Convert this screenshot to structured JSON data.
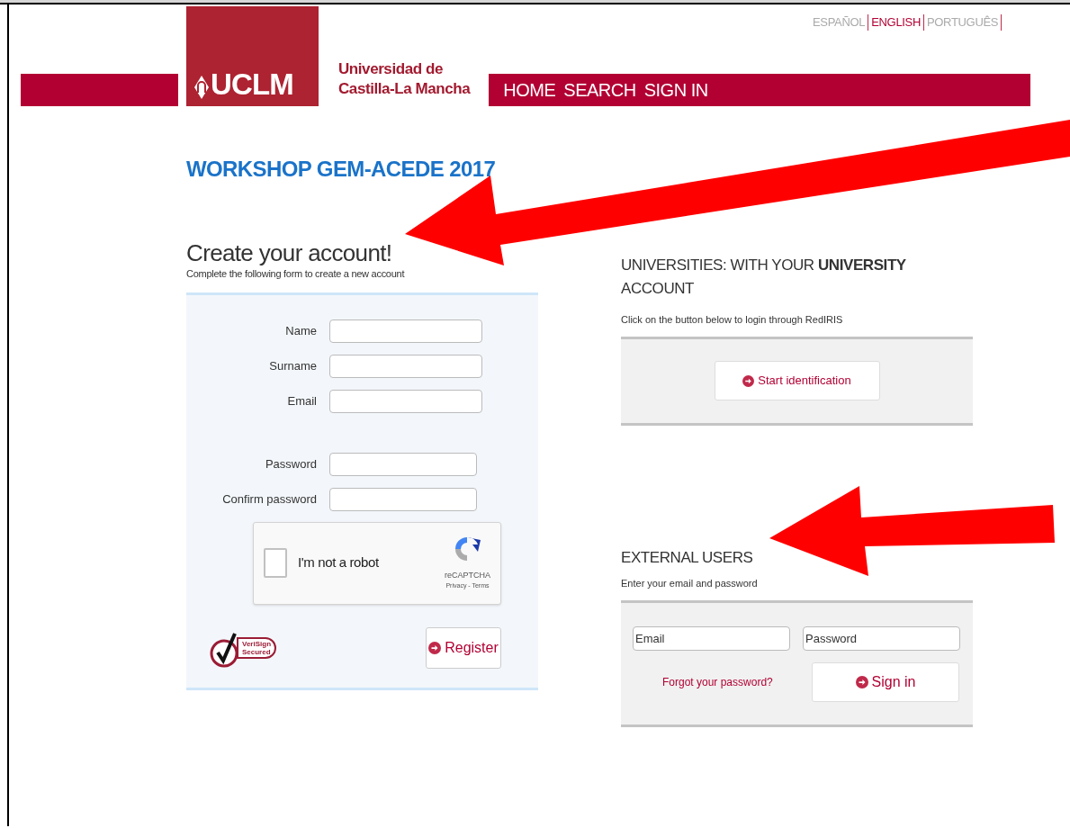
{
  "languages": [
    {
      "label": "ESPAÑOL",
      "selected": false
    },
    {
      "label": "ENGLISH",
      "selected": true
    },
    {
      "label": "PORTUGUÊS",
      "selected": false
    }
  ],
  "logo": {
    "text": "UCLM",
    "name_line1": "Universidad de",
    "name_line2": "Castilla-La Mancha"
  },
  "nav": [
    "HOME",
    "SEARCH",
    "SIGN IN"
  ],
  "title": "WORKSHOP GEM-ACEDE 2017",
  "register": {
    "heading": "Create your account!",
    "subtitle": "Complete the following form to create a new account",
    "fields": [
      {
        "label": "Name"
      },
      {
        "label": "Surname"
      },
      {
        "label": "Email"
      }
    ],
    "password_fields": [
      {
        "label": "Password"
      },
      {
        "label": "Confirm password"
      }
    ],
    "captcha": {
      "label": "I'm not a robot",
      "checked": false,
      "brand": "reCAPTCHA",
      "links": "Privacy - Terms"
    },
    "seal": {
      "line1": "VeriSign",
      "line2": "Secured"
    },
    "button": "Register"
  },
  "university": {
    "heading": "UNIVERSITIES: WITH YOUR **UNIVERSITY** ACCOUNT",
    "hint": "Click on the button below to login through RedIRIS",
    "button": "Start identification"
  },
  "external": {
    "heading": "EXTERNAL USERS",
    "hint": "Enter your email and password",
    "fields": [
      {
        "placeholder": "Email"
      },
      {
        "placeholder": "Password"
      }
    ],
    "forgot": "Forgot your password?",
    "button": "Sign in"
  }
}
